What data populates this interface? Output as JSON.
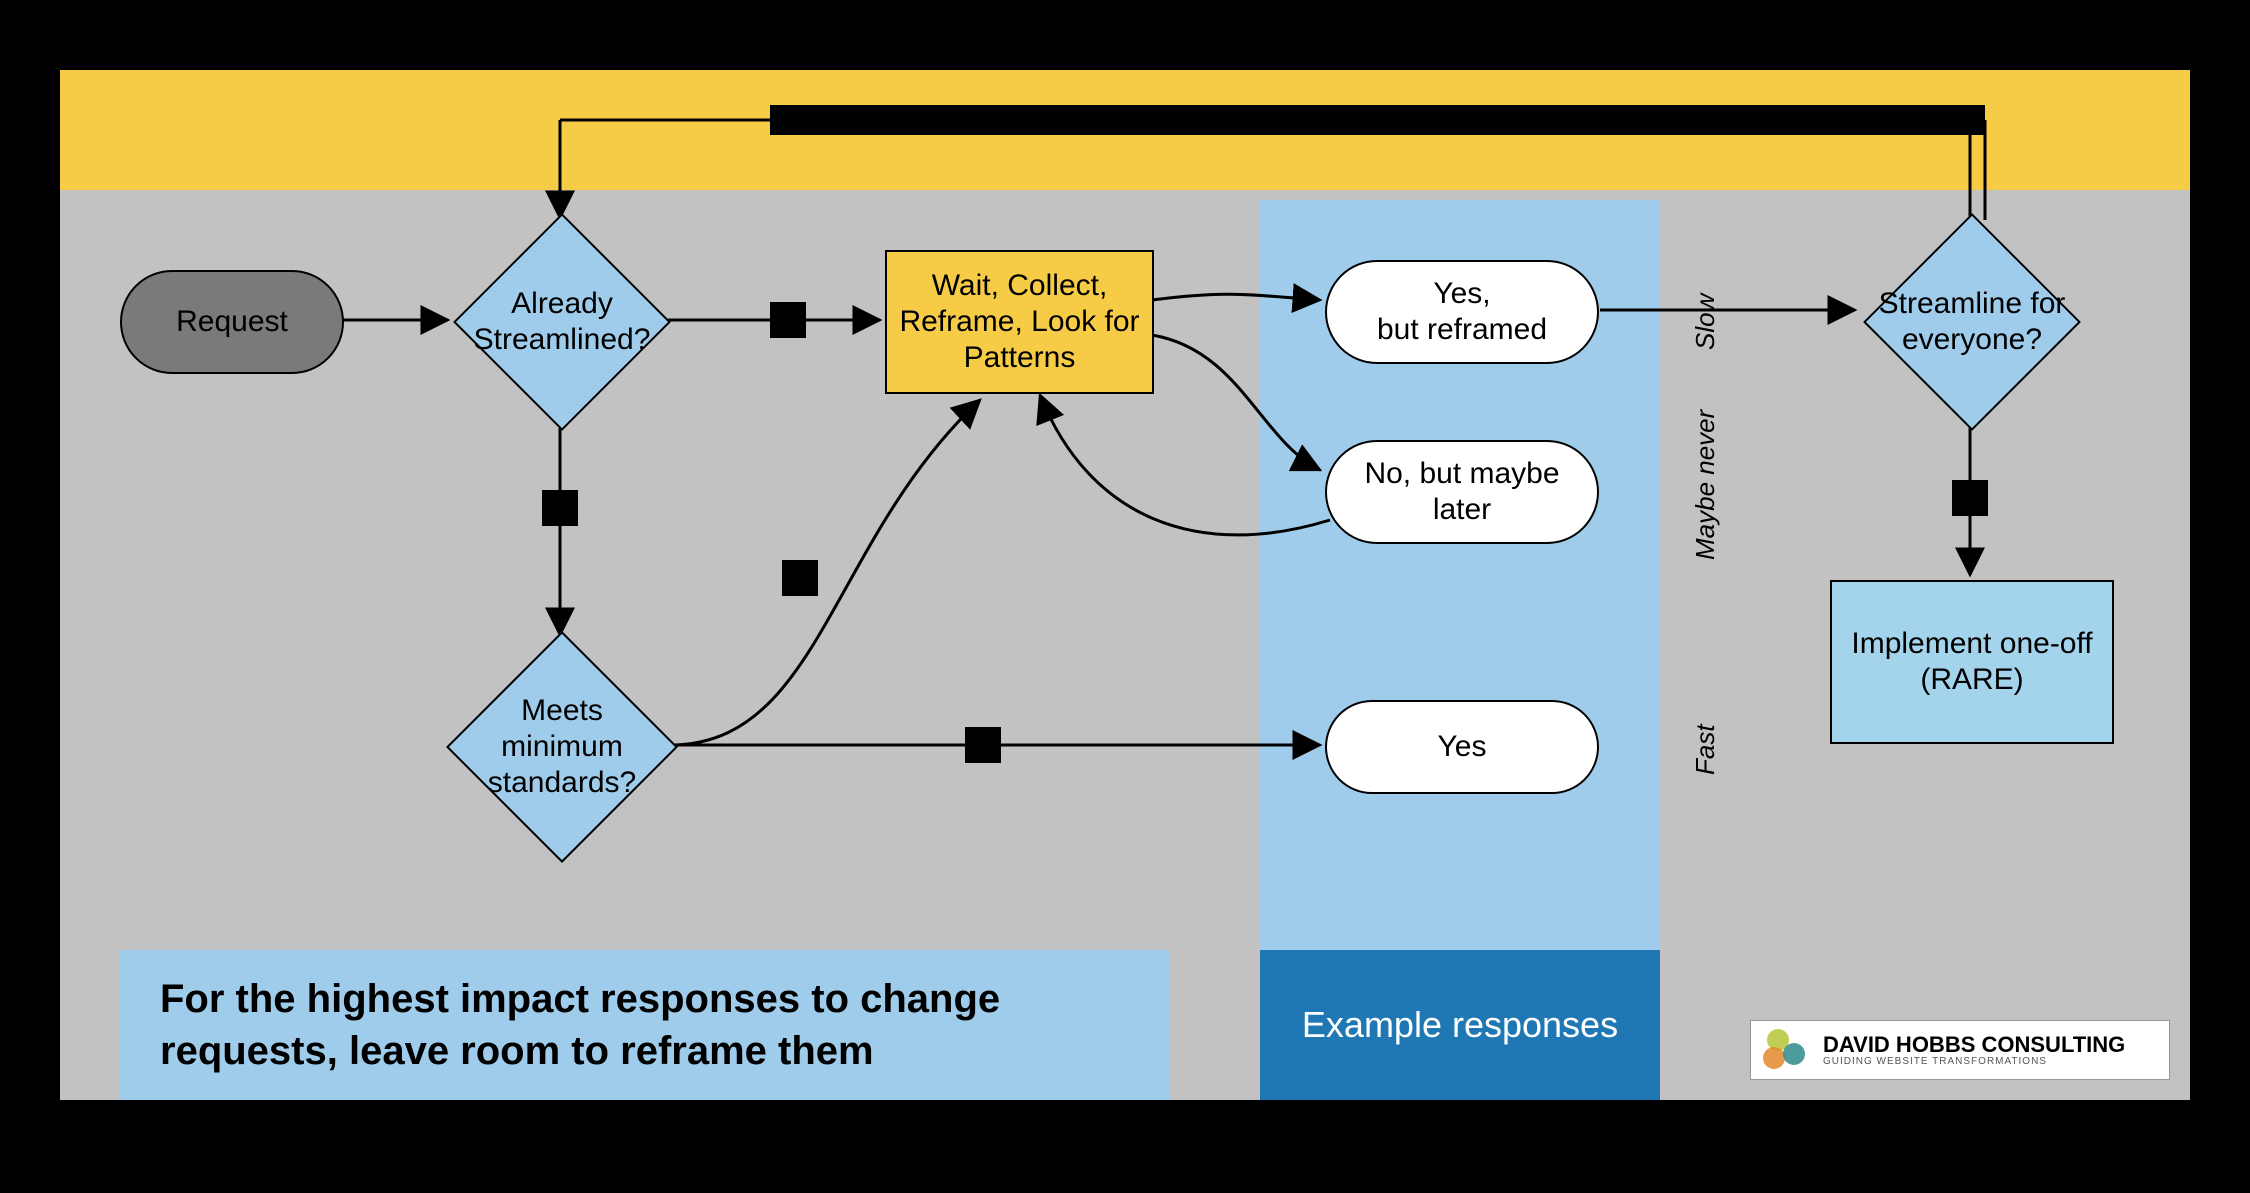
{
  "nodes": {
    "request": "Request",
    "alreadyStreamlined": "Already Streamlined?",
    "meetsStandards": "Meets minimum standards?",
    "wait": "Wait, Collect, Reframe, Look for Patterns",
    "streamlineEveryone": "Streamline for everyone?",
    "implement": "Implement one-off (RARE)"
  },
  "responses": {
    "yesReframed": "Yes,\nbut reframed",
    "noMaybe": "No, but maybe later",
    "yes": "Yes"
  },
  "sideLabels": {
    "slow": "Slow",
    "maybe": "Maybe never",
    "fast": "Fast"
  },
  "banners": {
    "example": "Example responses",
    "caption": "For the highest impact responses to change requests, leave room to reframe them"
  },
  "brand": {
    "line1": "DAVID HOBBS CONSULTING",
    "line2": "GUIDING WEBSITE TRANSFORMATIONS"
  },
  "colors": {
    "dot1": "#B6C637",
    "dot2": "#E08A2C",
    "dot3": "#2E8B8B"
  }
}
